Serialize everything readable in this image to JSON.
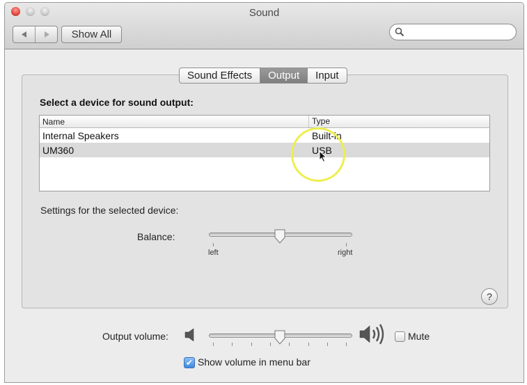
{
  "window": {
    "title": "Sound"
  },
  "toolbar": {
    "back_icon": "back-arrow-icon",
    "forward_icon": "forward-arrow-icon",
    "show_all_label": "Show All",
    "search_placeholder": ""
  },
  "tabs": [
    {
      "label": "Sound Effects",
      "selected": false
    },
    {
      "label": "Output",
      "selected": true
    },
    {
      "label": "Input",
      "selected": false
    }
  ],
  "output": {
    "heading": "Select a device for sound output:",
    "columns": [
      "Name",
      "Type"
    ],
    "devices": [
      {
        "name": "Internal Speakers",
        "type": "Built-in",
        "selected": false
      },
      {
        "name": "UM360",
        "type": "USB",
        "selected": true
      }
    ],
    "settings_label": "Settings for the selected device:",
    "balance": {
      "label": "Balance:",
      "left_label": "left",
      "right_label": "right",
      "value": 0.5
    }
  },
  "help_glyph": "?",
  "volume": {
    "label": "Output volume:",
    "value": 0.5,
    "mute_label": "Mute",
    "mute_checked": false
  },
  "menu_bar": {
    "label": "Show volume in menu bar",
    "checked": true,
    "check_glyph": "✔"
  },
  "colors": {
    "selected_tab": "#8a8a8a",
    "selected_row": "#dadada",
    "annotation_circle": "#eeee4c"
  }
}
